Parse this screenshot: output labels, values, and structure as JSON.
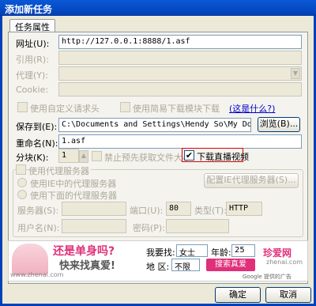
{
  "window": {
    "title": "添加新任务"
  },
  "tab": {
    "label": "任务属性"
  },
  "fields": {
    "url": {
      "label": "网址(U):",
      "value": "http://127.0.0.1:8888/1.asf"
    },
    "referer": {
      "label": "引用(R):",
      "value": ""
    },
    "proxy": {
      "label": "代理(Y):",
      "value": ""
    },
    "cookie": {
      "label": "Cookie:",
      "value": ""
    },
    "custom_header": {
      "label": "使用自定义请求头"
    },
    "simple_download": {
      "label": "使用简易下载模块下载"
    },
    "whats_this": {
      "label": "(这是什么?)"
    },
    "save_to": {
      "label": "保存到(E):",
      "value": "C:\\Documents and Settings\\Hendy So\\My Documents\\"
    },
    "browse": {
      "label": "浏览(B)..."
    },
    "rename": {
      "label": "重命名(N):",
      "value": "1.asf"
    },
    "blocks": {
      "label": "分块(K):",
      "value": "1"
    },
    "no_prefetch": {
      "label": "禁止预先获取文件大小"
    },
    "live_stream": {
      "label": "下载直播视频",
      "checked": "✔"
    }
  },
  "proxy_group": {
    "title": "使用代理服务器",
    "ie_proxy": "使用IE中的代理服务器",
    "config_btn": "配置IE代理服务器(S)...",
    "use_below": "使用下面的代理服务器",
    "server_label": "服务器(S):",
    "port_label": "端口(U):",
    "port_value": "80",
    "type_label": "类型(T):",
    "type_value": "HTTP",
    "user_label": "用户名(N):",
    "pwd_label": "密码(P):"
  },
  "ad": {
    "headline": "还是单身吗?",
    "sub": "快来找真爱!",
    "site": "www.zhenai.com",
    "find_label": "我要找:",
    "find_value": "女士",
    "age_label": "年龄:",
    "age_value": "25",
    "area_label": "地 区:",
    "area_value": "不限",
    "search_btn": "搜索真爱",
    "brand": "珍爱网",
    "brand_sub": "zhenai.com",
    "google_note": "Google 提供的广告"
  },
  "buttons": {
    "ok": "确定",
    "cancel": "取消"
  }
}
